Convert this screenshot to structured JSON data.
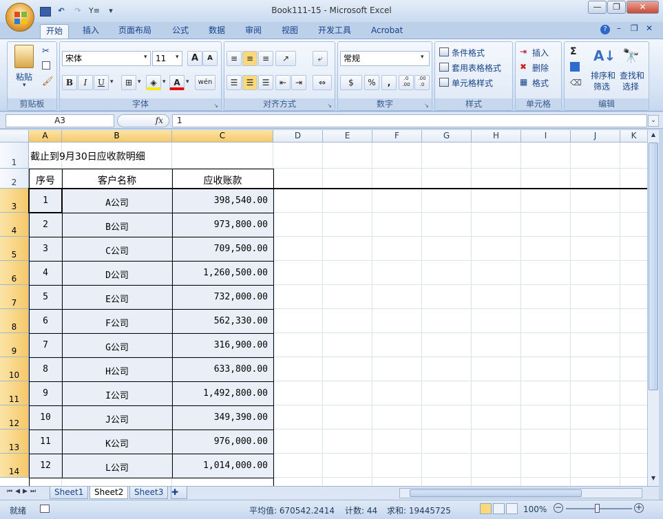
{
  "window": {
    "title": "Book111-15 - Microsoft Excel",
    "minimize": "—",
    "restore": "❐",
    "close": "✕"
  },
  "qat": {
    "save_icon": "💾",
    "undo_icon": "↶",
    "redo_icon": "↷",
    "custom": "Y≡",
    "more": "▾"
  },
  "tabs": [
    "开始",
    "插入",
    "页面布局",
    "公式",
    "数据",
    "审阅",
    "视图",
    "开发工具",
    "Acrobat"
  ],
  "ribbon": {
    "clipboard": {
      "paste": "粘贴",
      "group": "剪贴板"
    },
    "font": {
      "name": "宋体",
      "size": "11",
      "grow": "A",
      "shrink": "A",
      "bold": "B",
      "italic": "I",
      "underline": "U",
      "color_a": "A",
      "wen": "wén",
      "group": "字体"
    },
    "align": {
      "group": "对齐方式"
    },
    "number": {
      "format": "常规",
      "percent": "%",
      "comma": ",",
      "inc": ".0 .00",
      "dec": ".00 .0",
      "group": "数字"
    },
    "styles": {
      "cond": "条件格式",
      "table": "套用表格格式",
      "cell": "单元格样式",
      "group": "样式"
    },
    "cells": {
      "insert": "插入",
      "delete": "删除",
      "format": "格式",
      "group": "单元格"
    },
    "editing": {
      "sigma": "Σ",
      "sort": "排序和",
      "sort2": "筛选",
      "find": "查找和",
      "find2": "选择",
      "group": "编辑"
    }
  },
  "formula_bar": {
    "name_box": "A3",
    "fx": "fx",
    "value": "1"
  },
  "columns": [
    "A",
    "B",
    "C",
    "D",
    "E",
    "F",
    "G",
    "H",
    "I",
    "J",
    "K"
  ],
  "rows": [
    "1",
    "2",
    "3",
    "4",
    "5",
    "6",
    "7",
    "8",
    "9",
    "10",
    "11",
    "12",
    "13",
    "14"
  ],
  "sheet": {
    "title": "截止到9月30日应收款明细",
    "headers": [
      "序号",
      "客户名称",
      "应收账款"
    ],
    "records": [
      [
        "1",
        "A公司",
        "398,540.00"
      ],
      [
        "2",
        "B公司",
        "973,800.00"
      ],
      [
        "3",
        "C公司",
        "709,500.00"
      ],
      [
        "4",
        "D公司",
        "1,260,500.00"
      ],
      [
        "5",
        "E公司",
        "732,000.00"
      ],
      [
        "6",
        "F公司",
        "562,330.00"
      ],
      [
        "7",
        "G公司",
        "316,900.00"
      ],
      [
        "8",
        "H公司",
        "633,800.00"
      ],
      [
        "9",
        "I公司",
        "1,492,800.00"
      ],
      [
        "10",
        "J公司",
        "349,390.00"
      ],
      [
        "11",
        "K公司",
        "976,000.00"
      ],
      [
        "12",
        "L公司",
        "1,014,000.00"
      ]
    ]
  },
  "sheet_tabs": [
    "Sheet1",
    "Sheet2",
    "Sheet3"
  ],
  "status": {
    "ready": "就绪",
    "average": "平均值: 670542.2414",
    "count": "计数: 44",
    "sum": "求和: 19445725",
    "zoom": "100%"
  }
}
